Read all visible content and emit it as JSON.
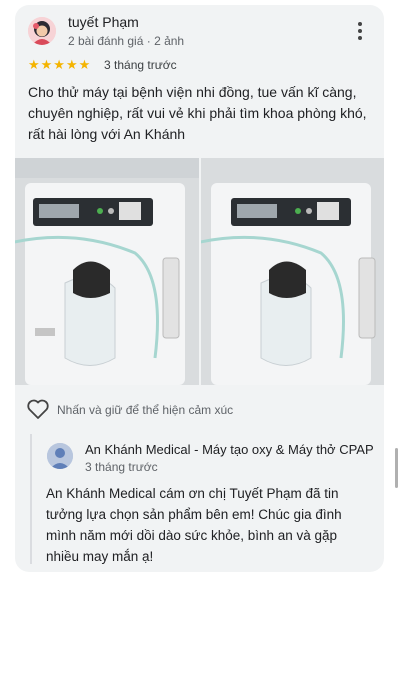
{
  "review": {
    "author_name": "tuyết Phạm",
    "author_meta": "2 bài đánh giá · 2 ảnh",
    "rating": 5,
    "stars_text": "★★★★★",
    "date": "3 tháng trước",
    "text": "Cho thử máy tại bệnh viện nhi đồng, tue vấn kĩ càng, chuyên nghiệp, rất vui vẻ khi phải tìm khoa phòng khó, rất hài lòng với An Khánh",
    "photos": [
      "oxygen-concentrator-photo-1",
      "oxygen-concentrator-photo-2"
    ],
    "like_hint": "Nhấn và giữ để thể hiện cảm xúc"
  },
  "owner_reply": {
    "name": "An Khánh Medical - Máy tạo oxy & Máy thở CPAP",
    "date": "3 tháng trước",
    "text": "An Khánh Medical cám ơn chị Tuyết Phạm đã tin tưởng lựa chọn sản phẩm bên em! Chúc gia đình mình năm mới dồi dào sức khỏe, bình an và gặp nhiều may mắn ạ!"
  },
  "icons": {
    "more": "more-vert-icon",
    "like": "heart-outline-icon",
    "star": "star-icon"
  },
  "colors": {
    "card_bg": "#f1f3f4",
    "star": "#f4b400",
    "secondary_text": "#5f6368"
  }
}
